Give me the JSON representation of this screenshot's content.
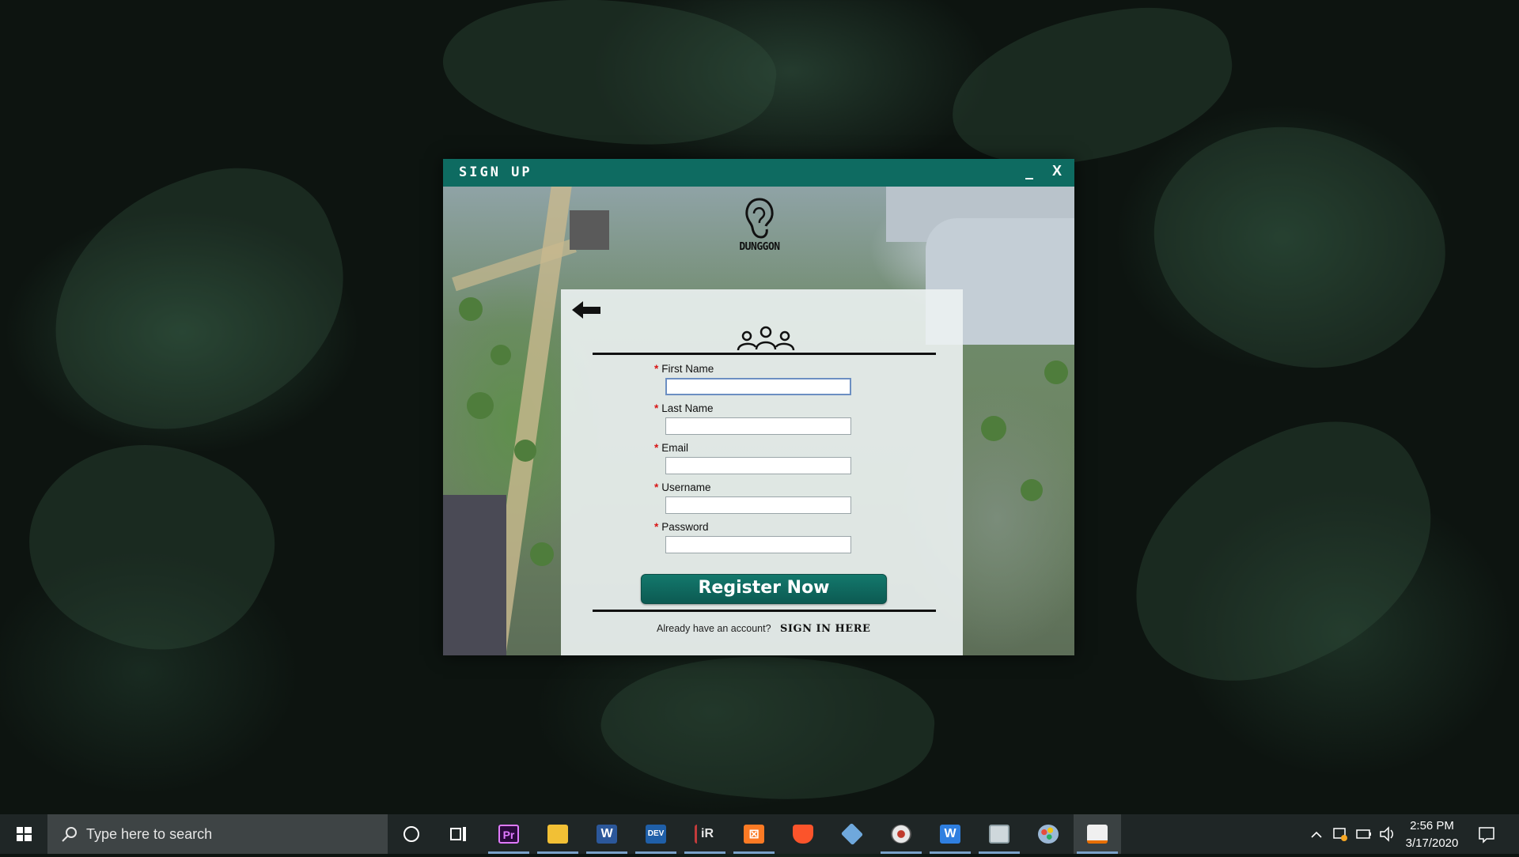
{
  "window": {
    "title": "SIGN UP",
    "minimize": "_",
    "close": "X",
    "brand": "DUNGGON"
  },
  "form": {
    "required_mark": "*",
    "fields": [
      {
        "label": "First Name",
        "value": ""
      },
      {
        "label": "Last Name",
        "value": ""
      },
      {
        "label": "Email",
        "value": ""
      },
      {
        "label": "Username",
        "value": ""
      },
      {
        "label": "Password",
        "value": ""
      }
    ],
    "register_label": "Register Now",
    "footer_text": "Already have an account?",
    "signin_label": "SIGN IN HERE"
  },
  "taskbar": {
    "search_placeholder": "Type here to search",
    "time": "2:56 PM",
    "date": "3/17/2020",
    "apps": [
      {
        "name": "cortana-icon"
      },
      {
        "name": "task-view-icon"
      },
      {
        "name": "premiere-pro-icon",
        "label": "Pr",
        "color": "#2b0a3d",
        "accent": "#e07aff"
      },
      {
        "name": "file-explorer-icon",
        "color": "#f2c035"
      },
      {
        "name": "word-icon",
        "label": "W",
        "color": "#2b579a"
      },
      {
        "name": "dev-cpp-icon",
        "label": "DEV",
        "color": "#1f5fa8"
      },
      {
        "name": "ireport-icon",
        "label": "iR",
        "color": "#c23b3b"
      },
      {
        "name": "xampp-icon",
        "label": "⊠",
        "color": "#fb7a24"
      },
      {
        "name": "brave-browser-icon",
        "color": "#fb542b"
      },
      {
        "name": "virtualbox-cube-icon",
        "color": "#6fa8dc"
      },
      {
        "name": "media-player-icon",
        "color": "#e8e8e8"
      },
      {
        "name": "wps-writer-icon",
        "label": "W",
        "color": "#2f7fe0"
      },
      {
        "name": "screen-app-icon",
        "color": "#cfd8dc"
      },
      {
        "name": "paint-icon",
        "color": "#9bb8d6"
      },
      {
        "name": "java-app-icon",
        "color": "#f0f0f0"
      }
    ]
  },
  "colors": {
    "title_bar": "#0e6b61",
    "register_button": "#0f6b61",
    "required_asterisk": "#d91414",
    "taskbar": "#1f2626"
  }
}
